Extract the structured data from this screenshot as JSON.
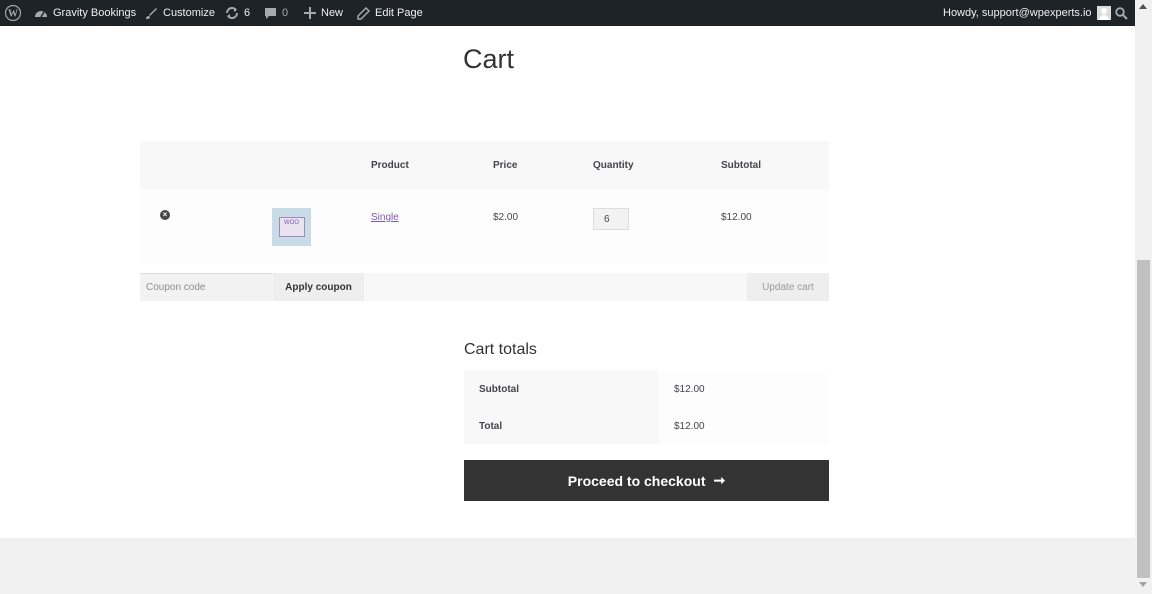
{
  "adminbar": {
    "site_name": "Gravity Bookings",
    "customize": "Customize",
    "updates_count": "6",
    "comments_count": "0",
    "new_label": "New",
    "edit_page": "Edit Page",
    "howdy": "Howdy, support@wpexperts.io"
  },
  "page": {
    "title": "Cart"
  },
  "cart": {
    "headers": {
      "product": "Product",
      "price": "Price",
      "quantity": "Quantity",
      "subtotal": "Subtotal"
    },
    "items": [
      {
        "remove_icon": "×",
        "thumbnail_text": "WOO",
        "name": "Single",
        "price": "$2.00",
        "quantity": "6",
        "subtotal": "$12.00"
      }
    ],
    "coupon_placeholder": "Coupon code",
    "apply_coupon": "Apply coupon",
    "update_cart": "Update cart"
  },
  "totals": {
    "title": "Cart totals",
    "rows": [
      {
        "label": "Subtotal",
        "value": "$12.00"
      },
      {
        "label": "Total",
        "value": "$12.00"
      }
    ],
    "checkout": "Proceed to checkout",
    "checkout_arrow": "➞"
  },
  "colors": {
    "adminbar": "#1d2327",
    "link": "#7f54b3",
    "checkout_bg": "#333333"
  }
}
